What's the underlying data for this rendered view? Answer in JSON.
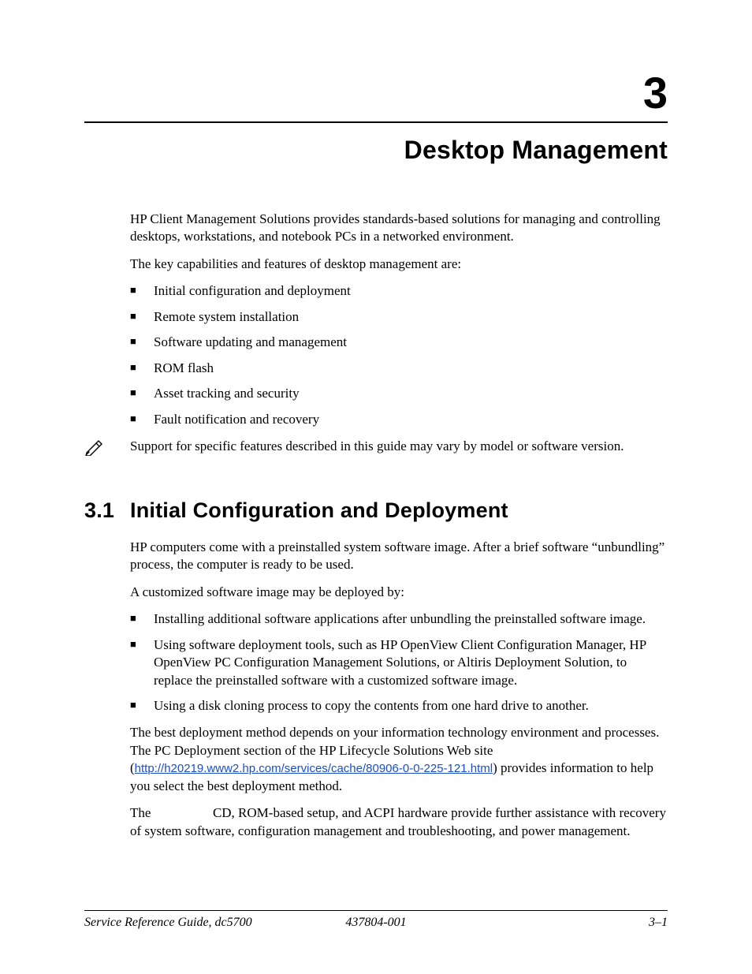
{
  "chapter": {
    "number": "3",
    "title": "Desktop Management"
  },
  "intro": {
    "p1": "HP Client Management Solutions provides standards-based solutions for managing and controlling desktops, workstations, and notebook PCs in a networked environment.",
    "p2": "The key capabilities and features of desktop management are:",
    "bullets": [
      "Initial configuration and deployment",
      "Remote system installation",
      "Software updating and management",
      "ROM flash",
      "Asset tracking and security",
      "Fault notification and recovery"
    ],
    "note": "Support for specific features described in this guide may vary by model or software version."
  },
  "section_3_1": {
    "number": "3.1",
    "title": "Initial Configuration and Deployment",
    "p1": "HP computers come with a preinstalled system software image. After a brief software “unbundling” process, the computer is ready to be used.",
    "p2": "A customized software image may be deployed by:",
    "bullets": [
      "Installing additional software applications after unbundling the preinstalled software image.",
      "Using software deployment tools, such as HP OpenView Client Configuration Manager, HP OpenView PC Configuration Management Solutions, or Altiris Deployment Solution, to replace the preinstalled software with a customized software image.",
      "Using a disk cloning process to copy the contents from one hard drive to another."
    ],
    "p3_a": "The best deployment method depends on your information technology environment and processes. The PC Deployment section of the HP Lifecycle Solutions Web site (",
    "p3_link": "http://h20219.www2.hp.com/services/cache/80906-0-0-225-121.html",
    "p3_b": ") provides information to help you select the best deployment method.",
    "p4_a": "The ",
    "p4_b": " CD, ROM-based setup, and ACPI hardware provide further assistance with recovery of system software, configuration management and troubleshooting, and power management."
  },
  "footer": {
    "left": "Service Reference Guide, dc5700",
    "center": "437804-001",
    "right": "3–1"
  }
}
